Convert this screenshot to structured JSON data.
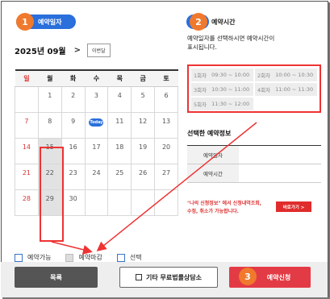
{
  "steps": [
    {
      "number": "1",
      "label": "예약일자"
    },
    {
      "number": "2",
      "label": "예약시간"
    },
    {
      "number": "3"
    }
  ],
  "calendar": {
    "month_title": "2025년 09월",
    "next_symbol": ">",
    "this_month_label": "이번달",
    "weekdays": [
      "일",
      "월",
      "화",
      "수",
      "목",
      "금",
      "토"
    ],
    "weeks": [
      [
        "",
        "1",
        "2",
        "3",
        "4",
        "5",
        "6"
      ],
      [
        "7",
        "8",
        "9",
        "",
        "11",
        "12",
        "13"
      ],
      [
        "14",
        "15",
        "16",
        "17",
        "18",
        "19",
        "20"
      ],
      [
        "21",
        "22",
        "23",
        "24",
        "25",
        "26",
        "27"
      ],
      [
        "28",
        "29",
        "30",
        "",
        "",
        "",
        ""
      ]
    ],
    "today_label": "Today"
  },
  "legend": {
    "available": "예약가능",
    "closed": "예약마감",
    "selected": "선택"
  },
  "time": {
    "hint_line1": "예약일자를 선택하시면 예약시간이",
    "hint_line2": "표시됩니다.",
    "slots": [
      {
        "label": "1회차",
        "time": "09:30 ~ 10:00"
      },
      {
        "label": "2회차",
        "time": "10:00 ~ 10:30"
      },
      {
        "label": "3회차",
        "time": "10:30 ~ 11:00"
      },
      {
        "label": "4회차",
        "time": "11:00 ~ 11:30"
      },
      {
        "label": "5회차",
        "time": "11:30 ~ 12:00"
      }
    ]
  },
  "selected_info": {
    "title": "선택한 예약정보",
    "date_label": "예약일자",
    "time_label": "예약시간",
    "date_value": "",
    "time_value": ""
  },
  "notice": {
    "line1": "\"나의 신청정보\" 에서 신청내역조회,",
    "line2": "수정, 취소가 가능합니다.",
    "go_button": "바로가기 >"
  },
  "buttons": {
    "list": "목록",
    "consult": "기타 무료법률상담소",
    "reserve": "예약신청"
  },
  "colors": {
    "accent_blue": "#2a6fdb",
    "step_orange": "#f0792d",
    "highlight_red": "#e33333",
    "reserve_red": "#e33b45"
  }
}
